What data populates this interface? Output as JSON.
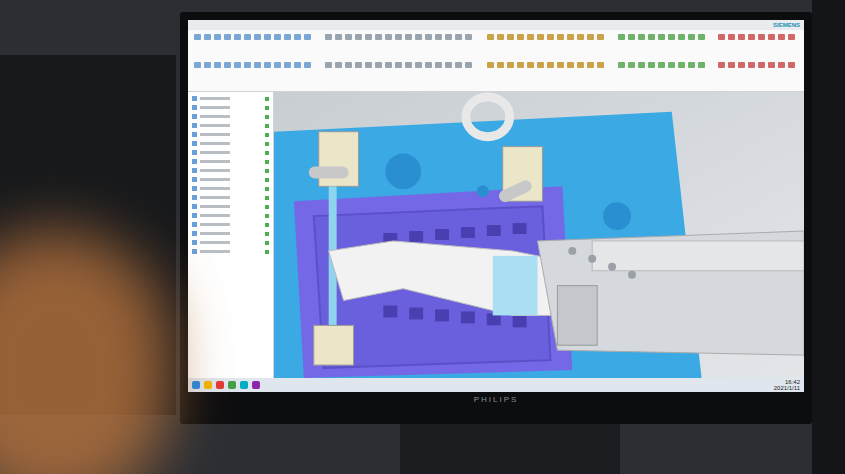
{
  "app": {
    "vendor": "SIEMENS"
  },
  "taskbar": {
    "time": "16:42",
    "date": "2021/1/11"
  },
  "monitor": {
    "brand": "PHILIPS"
  }
}
